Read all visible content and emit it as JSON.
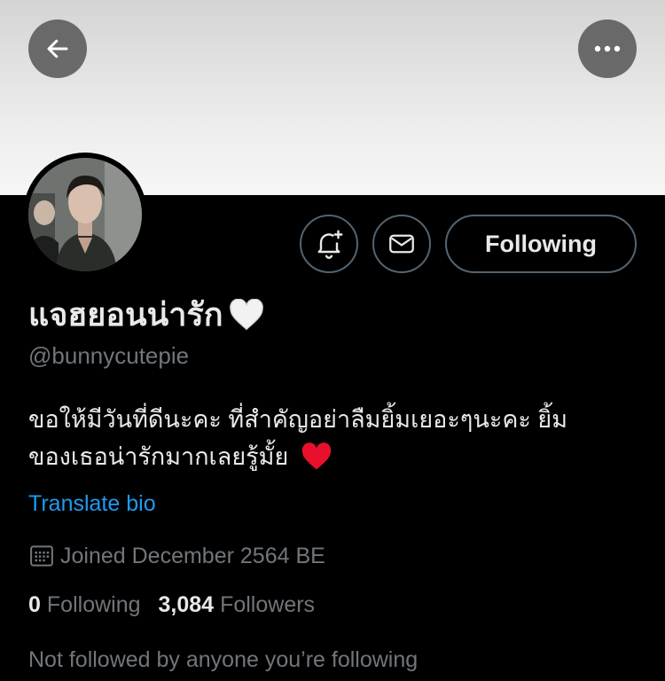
{
  "profile": {
    "display_name": "แจฮยอนน่ารัก",
    "name_emoji": "white-heart-icon",
    "handle": "@bunnycutepie",
    "bio_line1": "ขอให้มีวันที่ดีนะคะ ที่สำคัญอย่าลืมยิ้มเยอะๆนะคะ ยิ้ม",
    "bio_line2": "ของเธอน่ารักมากเลยรู้มั้ย",
    "bio_emoji": "red-heart-icon",
    "translate_label": "Translate bio",
    "joined": "Joined December 2564 BE",
    "following_count": "0",
    "following_label": "Following",
    "followers_count": "3,084",
    "followers_label": "Followers",
    "not_followed": "Not followed by anyone you’re following"
  },
  "actions": {
    "following_button": "Following"
  },
  "colors": {
    "background": "#000000",
    "text_primary": "#e7e9ea",
    "text_secondary": "#71767b",
    "link": "#1d9bf0",
    "border": "#536471"
  }
}
